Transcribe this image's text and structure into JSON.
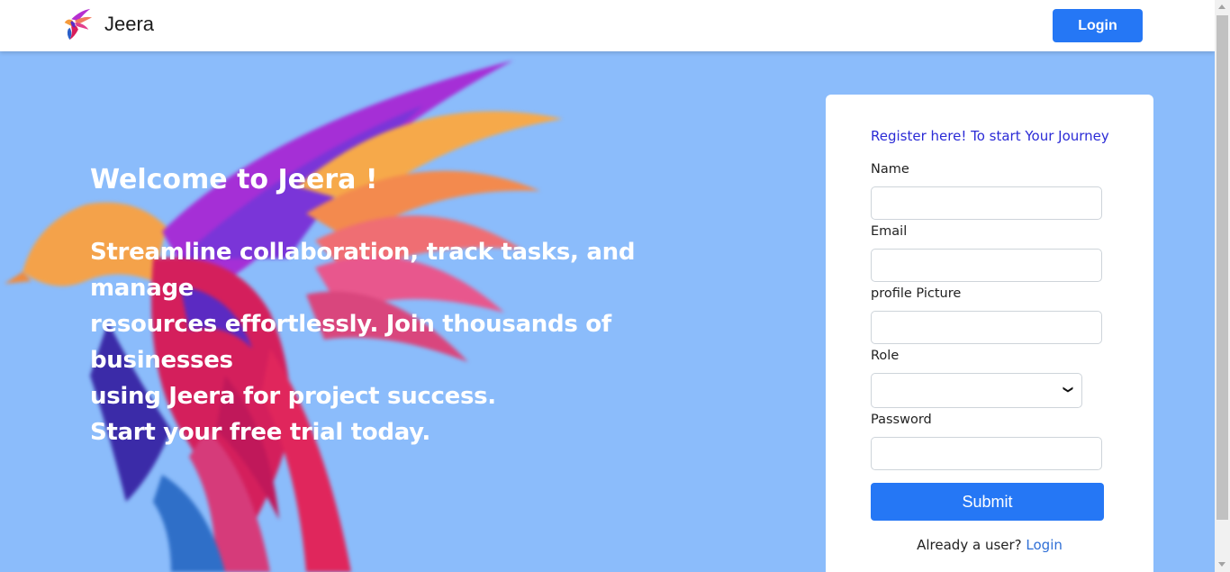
{
  "navbar": {
    "brand_name": "Jeera",
    "login_label": "Login"
  },
  "hero": {
    "title": "Welcome to Jeera !",
    "description_lines": [
      "Streamline collaboration, track tasks, and manage",
      "resources effortlessly. Join thousands of businesses",
      "using Jeera for project success.",
      "Start your free trial today."
    ]
  },
  "form": {
    "heading": "Register here! To start Your Journey",
    "fields": [
      {
        "label": "Name",
        "value": "",
        "placeholder": ""
      },
      {
        "label": "Email",
        "value": "",
        "placeholder": ""
      },
      {
        "label": "profile Picture",
        "value": "",
        "placeholder": ""
      },
      {
        "label": "Role",
        "value": ""
      },
      {
        "label": "Password",
        "value": "",
        "placeholder": ""
      }
    ],
    "submit_label": "Submit",
    "already_text": "Already a user?",
    "login_link": "Login"
  },
  "colors": {
    "background": "#8bbcfb",
    "primary_button": "#2577f5",
    "heading_link": "#2b2bd6"
  },
  "icons": {
    "brand_logo": "colorful-bird-logo",
    "select_arrow": "chevron-down-icon"
  }
}
